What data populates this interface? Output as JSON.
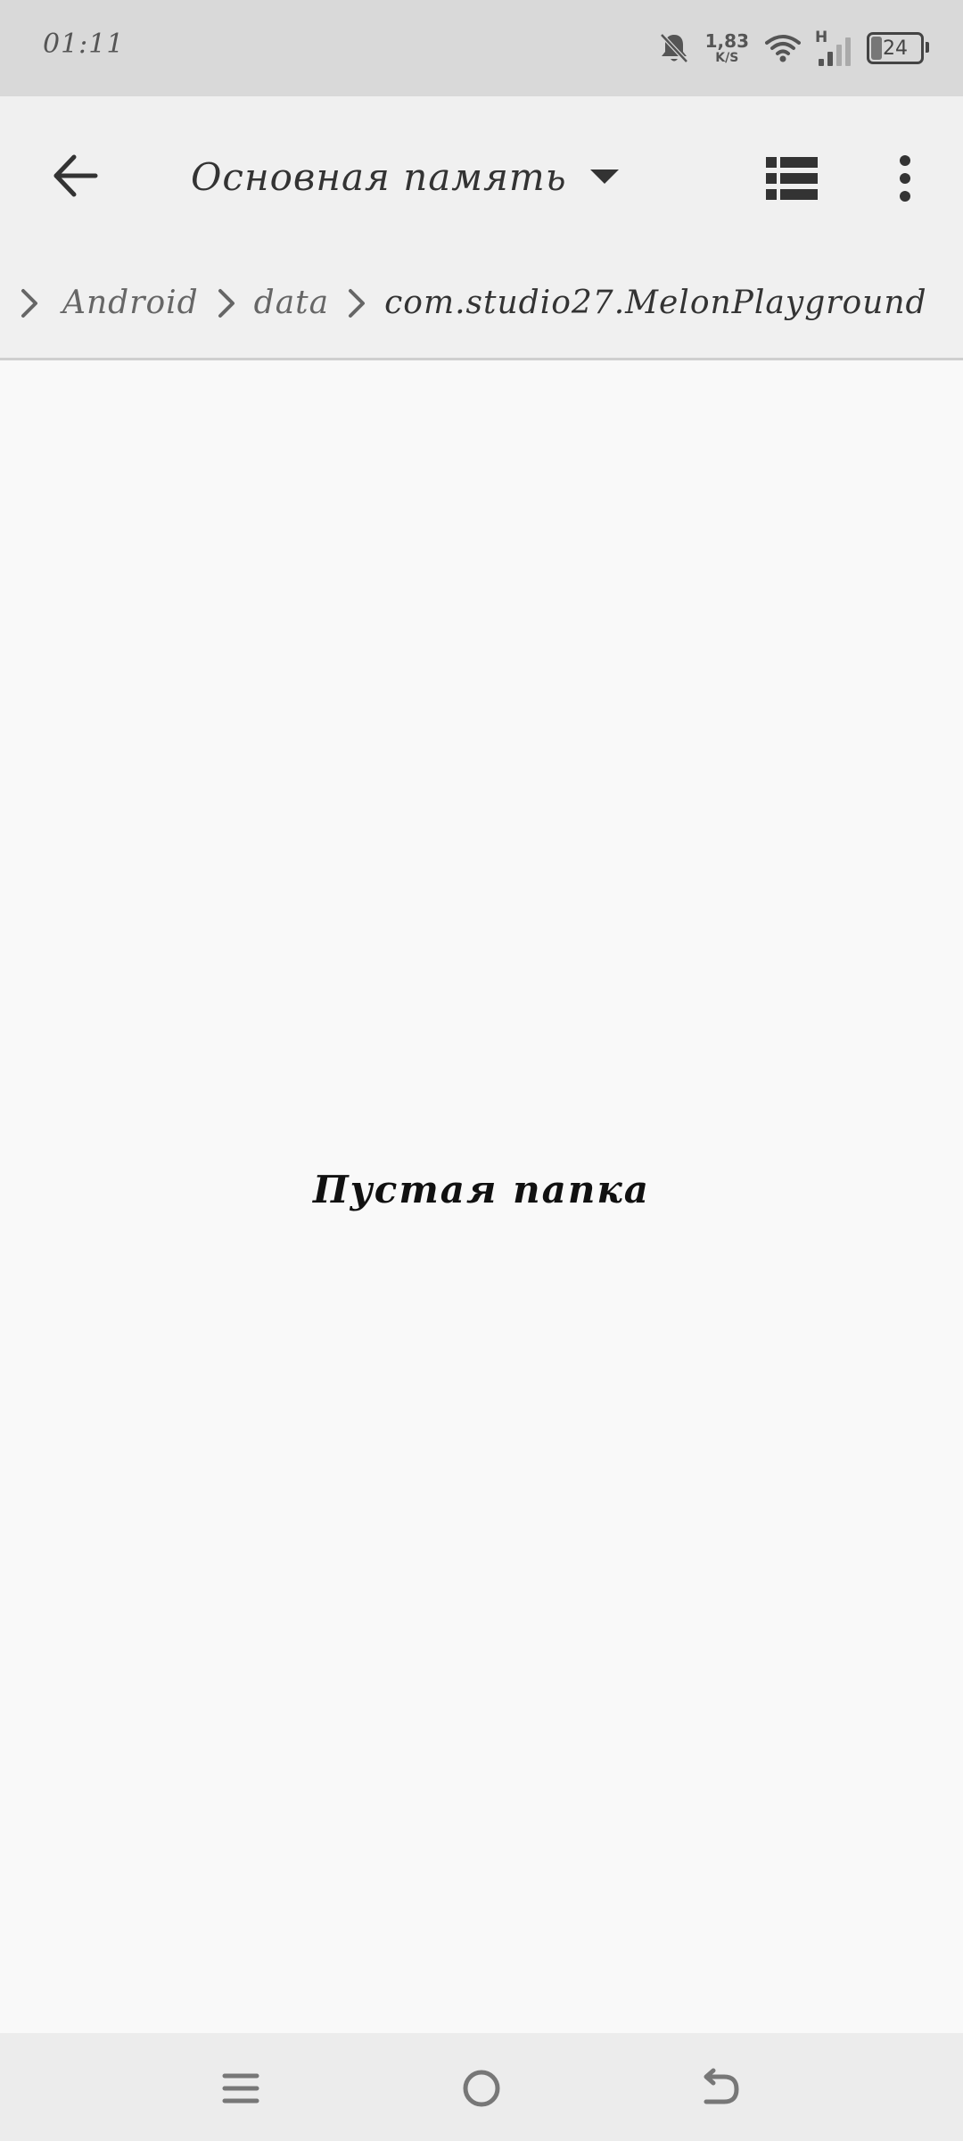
{
  "status_bar": {
    "time": "01:11",
    "net_speed_value": "1,83",
    "net_speed_unit": "K/S",
    "network_type": "H",
    "battery_percent": "24",
    "icons": [
      "bell-off-icon",
      "wifi-icon",
      "signal-icon",
      "battery-icon"
    ]
  },
  "app_bar": {
    "title": "Основная память",
    "icons": [
      "arrow-left-icon",
      "caret-down-icon",
      "list-view-icon",
      "more-vertical-icon"
    ]
  },
  "breadcrumb": {
    "items": [
      "Android",
      "data",
      "com.studio27.MelonPlayground"
    ]
  },
  "content": {
    "empty_message": "Пустая папка"
  },
  "nav_bar": {
    "icons": [
      "menu-icon",
      "home-icon",
      "back-icon"
    ]
  },
  "colors": {
    "status_bar_bg": "#d9d9d9",
    "app_bar_bg": "#f0f0f0",
    "content_bg": "#f9f9f9",
    "icon_color": "#444444"
  }
}
